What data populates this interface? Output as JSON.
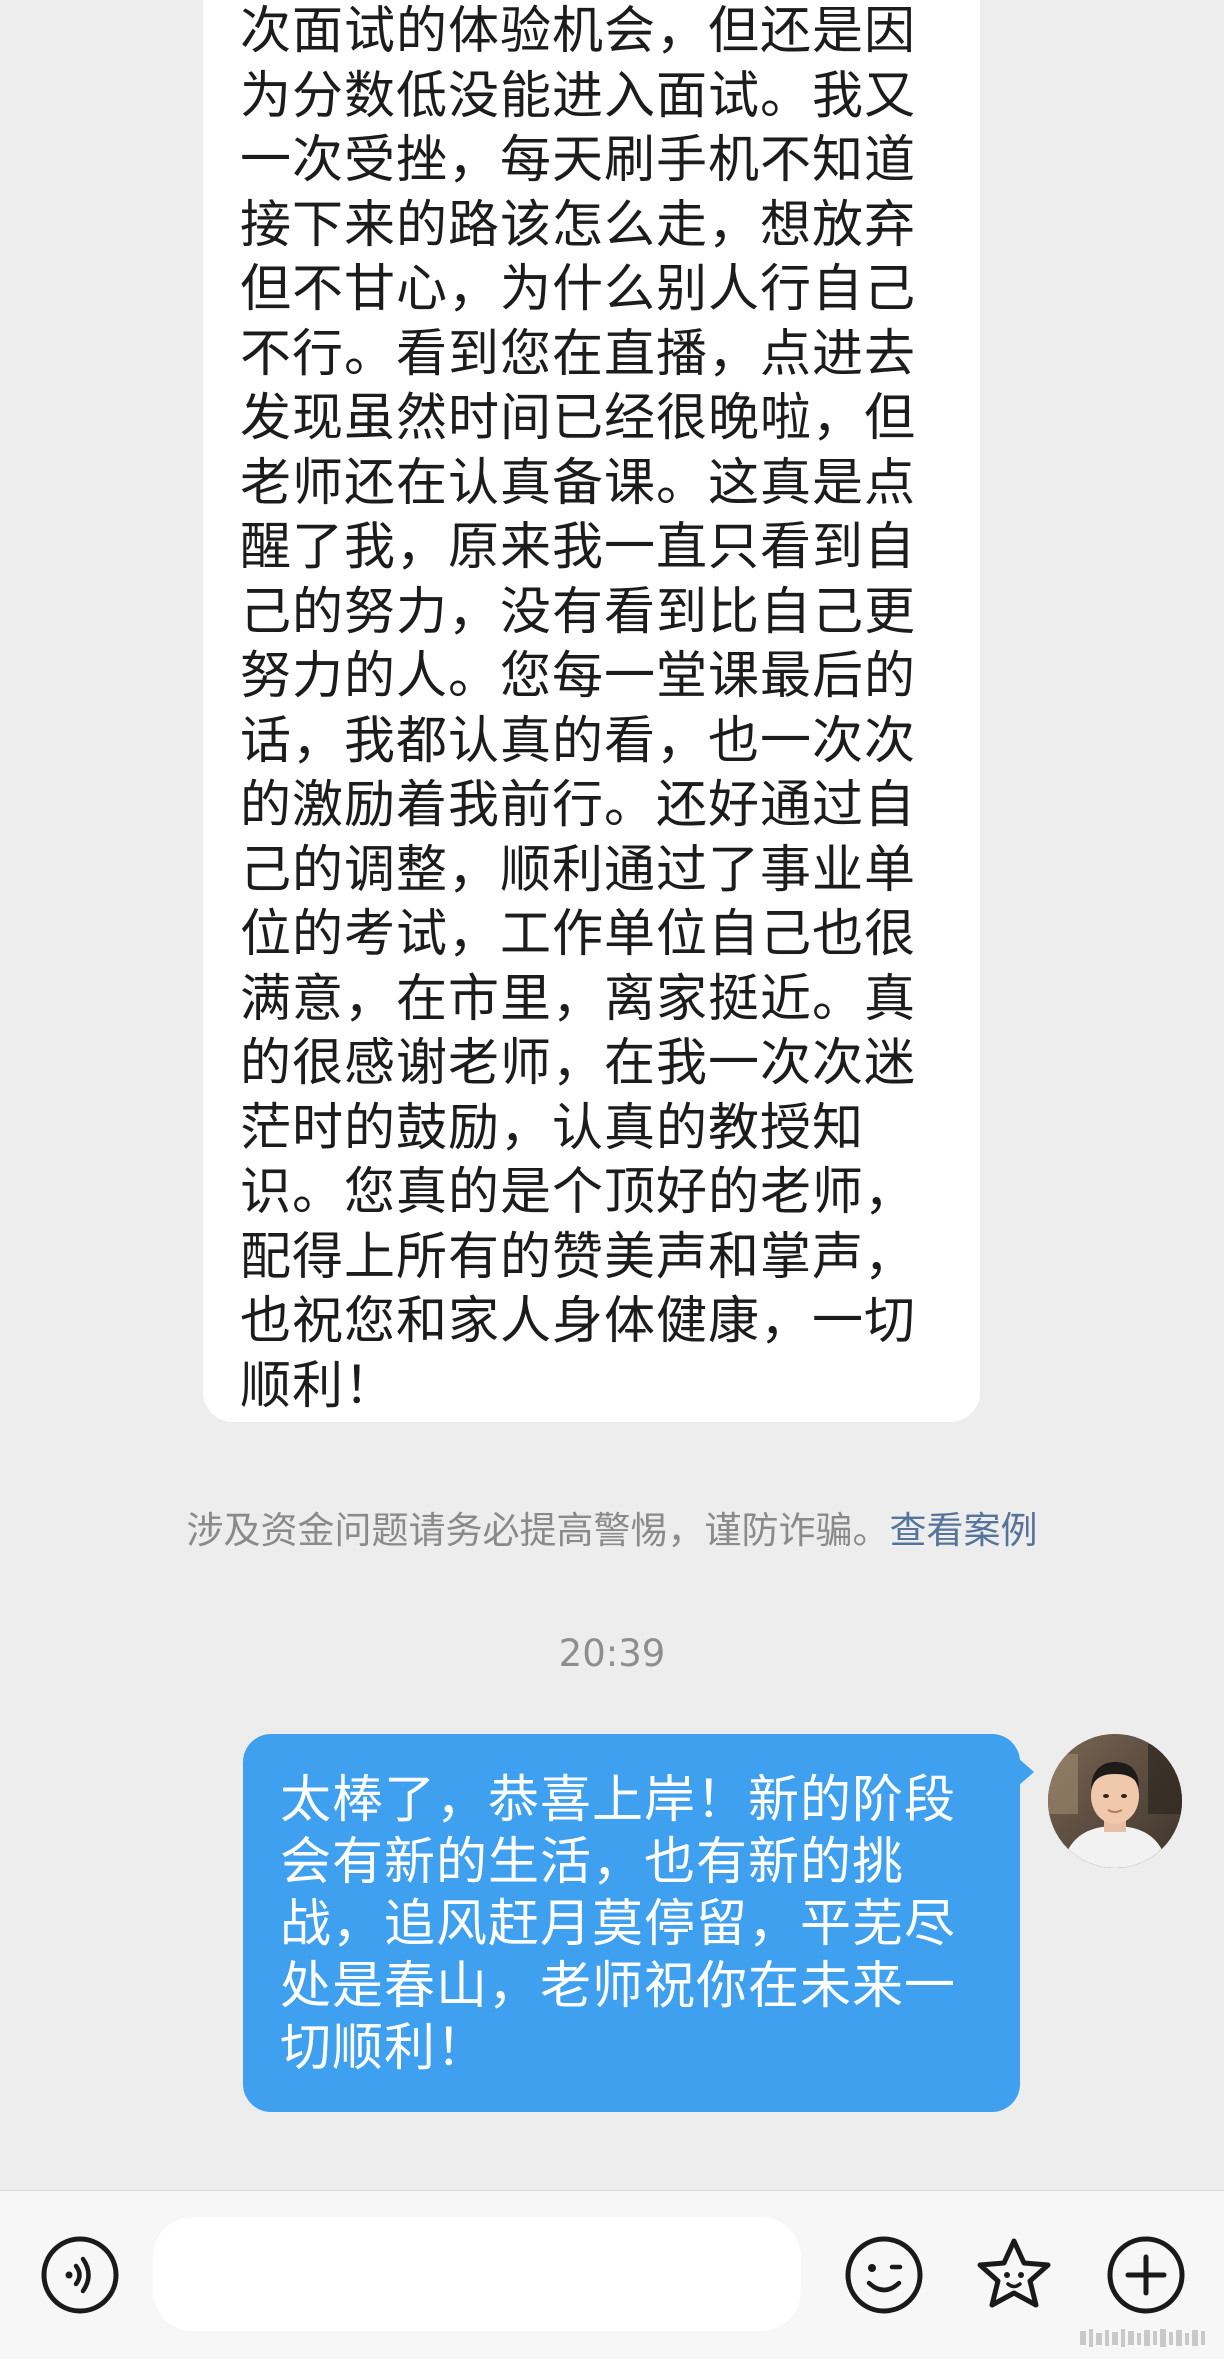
{
  "incoming_message": {
    "lines": [
      "次面试的体验机会，但还是因",
      "为分数低没能进入面试。我又",
      "一次受挫，每天刷手机不知道",
      "接下来的路该怎么走，想放弃",
      "但不甘心，为什么别人行自己",
      "不行。看到您在直播，点进去",
      "发现虽然时间已经很晚啦，但",
      "老师还在认真备课。这真是点",
      "醒了我，原来我一直只看到自",
      "己的努力，没有看到比自己更",
      "努力的人。您每一堂课最后的",
      "话，我都认真的看，也一次次",
      "的激励着我前行。还好通过自",
      "己的调整，顺利通过了事业单",
      "位的考试，工作单位自己也很",
      "满意，在市里，离家挺近。真",
      "的很感谢老师，在我一次次迷",
      "茫时的鼓励，认真的教授知",
      "识。您真的是个顶好的老师，",
      "配得上所有的赞美声和掌声，",
      "也祝您和家人身体健康，一切",
      "顺利！"
    ]
  },
  "notice": {
    "text": "涉及资金问题请务必提高警惕，谨防诈骗。",
    "link": "查看案例"
  },
  "timestamp": "20:39",
  "outgoing_message": {
    "lines": [
      "太棒了，恭喜上岸！新的阶段",
      "会有新的生活，也有新的挑",
      "战，追风赶月莫停留，平芜尽",
      "处是春山，老师祝你在未来一",
      "切顺利！"
    ]
  },
  "input_bar": {
    "placeholder": "",
    "icons": [
      "voice-icon",
      "emoji-icon",
      "sticker-icon",
      "plus-icon"
    ]
  },
  "colors": {
    "background": "#ededed",
    "incoming_bubble": "#ffffff",
    "outgoing_bubble": "#3fa0ef",
    "link": "#56739b"
  }
}
